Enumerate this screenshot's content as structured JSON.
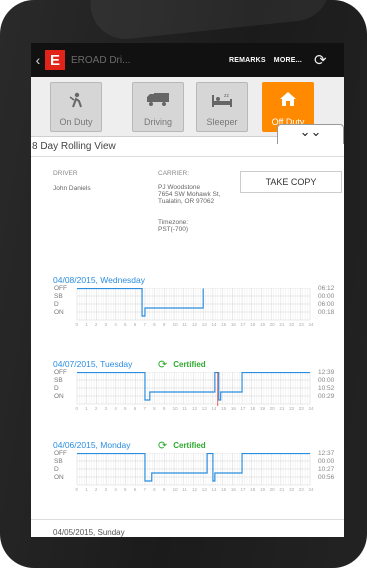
{
  "header": {
    "title": "EROAD Dri...",
    "remarks_label": "REMARKS",
    "more_label": "MORE...",
    "logo_text": "E"
  },
  "statuses": [
    {
      "label": "On Duty",
      "icon": "on-duty-icon",
      "active": false
    },
    {
      "label": "Driving",
      "icon": "truck-icon",
      "active": false
    },
    {
      "label": "Sleeper",
      "icon": "bed-icon",
      "active": false
    },
    {
      "label": "Off Duty",
      "icon": "home-icon",
      "active": true
    }
  ],
  "colors": {
    "accent": "#ff8a00",
    "link": "#2b8de0",
    "certified": "#2faa2f",
    "brand": "#e2231a"
  },
  "view_title": "8 Day Rolling View",
  "driver": {
    "label": "DRIVER",
    "name": "John Daniels"
  },
  "carrier": {
    "label": "CARRIER:",
    "name": "PJ Woodstone",
    "address1": "7654 SW Mohawk St,",
    "address2": "Tualatin, OR 97062",
    "timezone_label": "Timezone:",
    "timezone": "PST(-700)"
  },
  "take_copy_label": "TAKE COPY",
  "row_labels": [
    "OFF",
    "SB",
    "D",
    "ON"
  ],
  "hours": [
    "0",
    "1",
    "2",
    "3",
    "4",
    "5",
    "6",
    "7",
    "8",
    "9",
    "10",
    "11",
    "12",
    "13",
    "14",
    "15",
    "16",
    "17",
    "18",
    "19",
    "20",
    "21",
    "22",
    "23",
    "24"
  ],
  "days": [
    {
      "title": "04/08/2015, Wednesday",
      "certified": "",
      "totals": [
        "06:12",
        "00:00",
        "06:00",
        "00:18"
      ],
      "segments": [
        {
          "row": 0,
          "start": 0,
          "end": 6.7
        },
        {
          "row": 3,
          "start": 6.7,
          "end": 7.0
        },
        {
          "row": 2,
          "start": 7.0,
          "end": 13.0
        },
        {
          "row": 0,
          "start": 13.0,
          "end": 13.0
        }
      ],
      "current_time": null
    },
    {
      "title": "04/07/2015, Tuesday",
      "certified": "Certified",
      "totals": [
        "12:39",
        "00:00",
        "10:52",
        "00:29"
      ],
      "segments": [
        {
          "row": 0,
          "start": 0,
          "end": 7.0
        },
        {
          "row": 3,
          "start": 7.0,
          "end": 7.5
        },
        {
          "row": 2,
          "start": 7.5,
          "end": 14.2
        },
        {
          "row": 0,
          "start": 14.2,
          "end": 14.6
        },
        {
          "row": 3,
          "start": 14.6,
          "end": 14.8
        },
        {
          "row": 2,
          "start": 14.8,
          "end": 17.0
        },
        {
          "row": 0,
          "start": 17.0,
          "end": 24
        }
      ],
      "current_time": 14.5
    },
    {
      "title": "04/06/2015, Monday",
      "certified": "Certified",
      "totals": [
        "12:37",
        "00:00",
        "10:27",
        "00:56"
      ],
      "segments": [
        {
          "row": 0,
          "start": 0,
          "end": 7.0
        },
        {
          "row": 3,
          "start": 7.0,
          "end": 7.7
        },
        {
          "row": 2,
          "start": 7.7,
          "end": 13.4
        },
        {
          "row": 0,
          "start": 13.4,
          "end": 14.0
        },
        {
          "row": 3,
          "start": 14.0,
          "end": 14.2
        },
        {
          "row": 2,
          "start": 14.2,
          "end": 17.0
        },
        {
          "row": 0,
          "start": 17.0,
          "end": 24
        }
      ],
      "current_time": null
    }
  ],
  "next_day_title": "04/05/2015, Sunday"
}
